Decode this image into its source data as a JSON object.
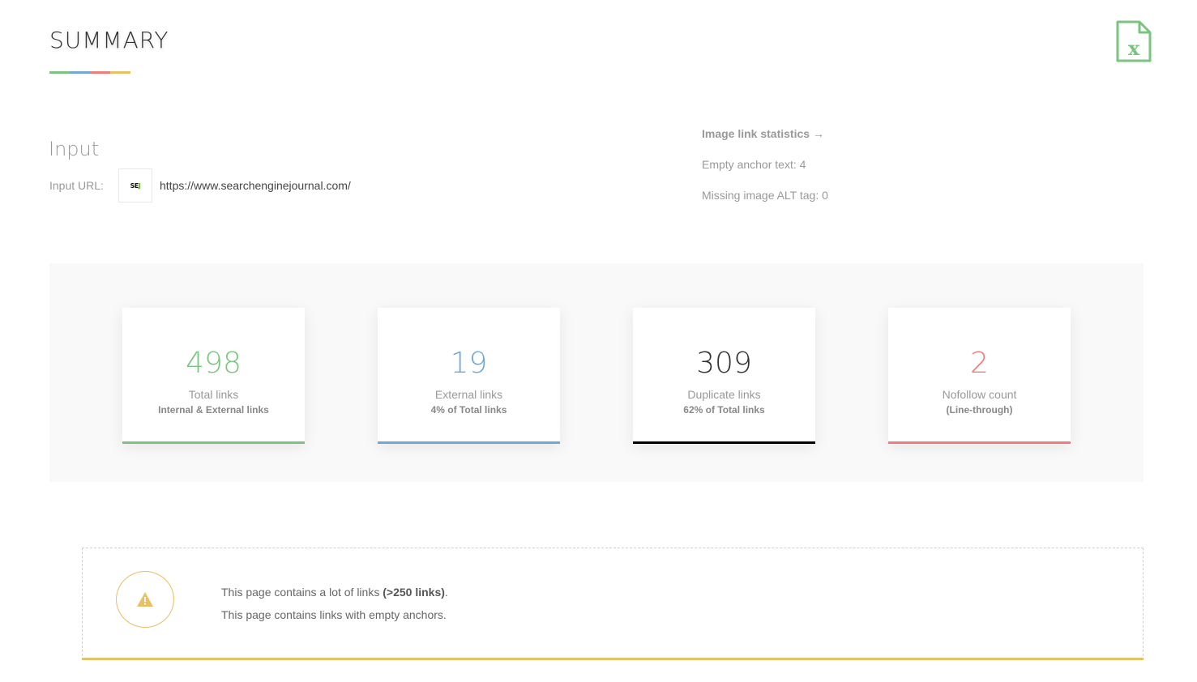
{
  "header": {
    "title": "SUMMARY",
    "title_bar_colors": [
      "#7bc47f",
      "#6fa8d6",
      "#f07b7b",
      "#e8c065"
    ],
    "export_icon": "excel-file-icon",
    "export_color": "#7bc47f"
  },
  "input": {
    "heading": "Input",
    "url_label": "Input URL:",
    "favicon_text_main": "SE",
    "favicon_text_accent": "J",
    "url": "https://www.searchenginejournal.com/"
  },
  "image_stats": {
    "title": "Image link statistics →",
    "items": [
      {
        "label": "Empty anchor text: 4"
      },
      {
        "label": "Missing image ALT tag: 0"
      }
    ]
  },
  "cards": [
    {
      "value": "498",
      "label": "Total links",
      "sub": "Internal & External links",
      "color": "#7bc47f"
    },
    {
      "value": "19",
      "label": "External links",
      "sub": "4% of Total links",
      "color": "#6fa8d6"
    },
    {
      "value": "309",
      "label": "Duplicate links",
      "sub": "62% of Total links",
      "color": "#333333",
      "bar_color": "#000000"
    },
    {
      "value": "2",
      "label": "Nofollow count",
      "sub": "(Line-through)",
      "color": "#f07b7b"
    }
  ],
  "warnings": {
    "icon": "warning-triangle-icon",
    "color": "#e8c065",
    "messages": [
      {
        "text": "This page contains a lot of links ",
        "bold": "(>250 links)",
        "suffix": "."
      },
      {
        "text": "This page contains links with empty anchors.",
        "bold": "",
        "suffix": ""
      }
    ]
  }
}
